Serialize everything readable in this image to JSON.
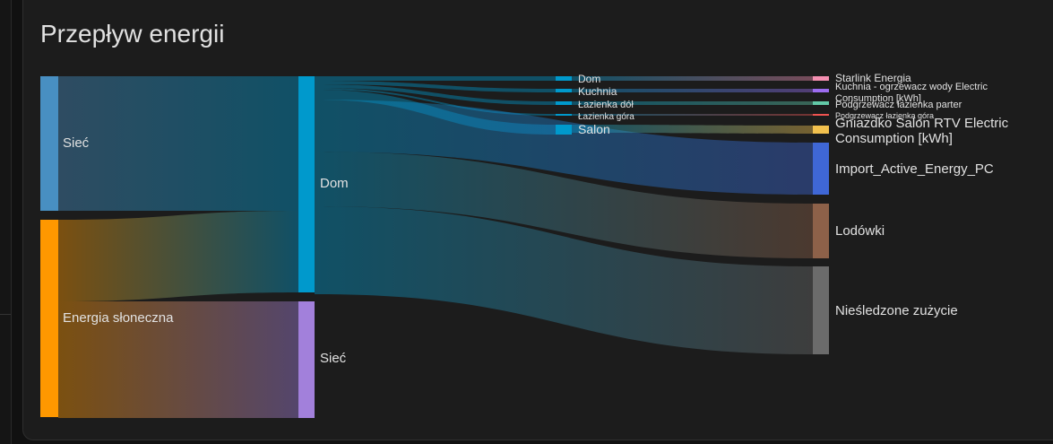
{
  "card": {
    "title": "Przepływ energii"
  },
  "chart_data": {
    "type": "sankey",
    "title": "Przepływ energii",
    "unit": "kWh",
    "nodes": [
      {
        "id": "src_grid",
        "label": "Sieć",
        "column": 0,
        "color": "#488fc2"
      },
      {
        "id": "src_solar",
        "label": "Energia słoneczna",
        "column": 0,
        "color": "#ff9800"
      },
      {
        "id": "home",
        "label": "Dom",
        "column": 1,
        "color": "#0099cc"
      },
      {
        "id": "to_grid",
        "label": "Sieć",
        "column": 1,
        "color": "#a280db"
      },
      {
        "id": "area_dom",
        "label": "Dom",
        "column": 2,
        "color": "#0099cc"
      },
      {
        "id": "area_kuchnia",
        "label": "Kuchnia",
        "column": 2,
        "color": "#0099cc"
      },
      {
        "id": "area_lazienka_dol",
        "label": "Łazienka dół",
        "column": 2,
        "color": "#0099cc"
      },
      {
        "id": "area_lazienka_gora",
        "label": "Łazienka góra",
        "column": 2,
        "color": "#0099cc"
      },
      {
        "id": "area_salon",
        "label": "Salon",
        "column": 2,
        "color": "#0099cc"
      },
      {
        "id": "dev_starlink",
        "label": "Starlink Energia",
        "column": 3,
        "color": "#f48fb1"
      },
      {
        "id": "dev_kuchnia",
        "label": "Kuchnia - ogrzewacz wody Electric Consumption [kWh]",
        "column": 3,
        "color": "#9c6cf0"
      },
      {
        "id": "dev_podgrzewacz_parter",
        "label": "Podgrzewacz łazienka parter",
        "column": 3,
        "color": "#62c9a7"
      },
      {
        "id": "dev_podgrzewacz_gora",
        "label": "Podgrzewacz łazienka góra",
        "column": 3,
        "color": "#ef5350"
      },
      {
        "id": "dev_gniazdko",
        "label": "Gniazdko Salon RTV Electric Consumption [kWh]",
        "column": 3,
        "color": "#f2c14e"
      },
      {
        "id": "dev_pc",
        "label": "Import_Active_Energy_PC",
        "column": 3,
        "color": "#3f67d6"
      },
      {
        "id": "dev_lodowki",
        "label": "Lodówki",
        "column": 3,
        "color": "#8d6149"
      },
      {
        "id": "dev_untracked",
        "label": "Nieśledzone zużycie",
        "column": 3,
        "color": "#6b6b6b"
      }
    ],
    "links": [
      {
        "source": "src_grid",
        "target": "home",
        "value": 7.3
      },
      {
        "source": "src_solar",
        "target": "home",
        "value": 3.5
      },
      {
        "source": "src_solar",
        "target": "to_grid",
        "value": 6.2
      },
      {
        "source": "home",
        "target": "area_dom",
        "value": 0.2
      },
      {
        "source": "home",
        "target": "area_kuchnia",
        "value": 0.2
      },
      {
        "source": "home",
        "target": "area_lazienka_dol",
        "value": 0.15
      },
      {
        "source": "home",
        "target": "area_lazienka_gora",
        "value": 0.1
      },
      {
        "source": "home",
        "target": "area_salon",
        "value": 0.4
      },
      {
        "source": "home",
        "target": "dev_pc",
        "value": 1.75
      },
      {
        "source": "home",
        "target": "dev_lodowki",
        "value": 1.85
      },
      {
        "source": "home",
        "target": "dev_untracked",
        "value": 3.0
      },
      {
        "source": "area_dom",
        "target": "dev_starlink",
        "value": 0.2
      },
      {
        "source": "area_kuchnia",
        "target": "dev_kuchnia",
        "value": 0.2
      },
      {
        "source": "area_lazienka_dol",
        "target": "dev_podgrzewacz_parter",
        "value": 0.15
      },
      {
        "source": "area_lazienka_gora",
        "target": "dev_podgrzewacz_gora",
        "value": 0.1
      },
      {
        "source": "area_salon",
        "target": "dev_gniazdko",
        "value": 0.4
      }
    ]
  }
}
